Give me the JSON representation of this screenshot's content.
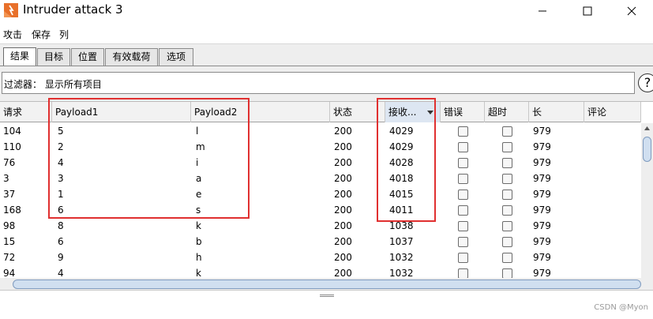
{
  "window": {
    "title": "Intruder attack 3"
  },
  "menu": [
    "攻击",
    "保存",
    "列"
  ],
  "tabs": [
    "结果",
    "目标",
    "位置",
    "有效载荷",
    "选项"
  ],
  "filter": {
    "text": "过滤器：  显示所有项目"
  },
  "help_label": "?",
  "table": {
    "columns": [
      "请求",
      "Payload1",
      "Payload2",
      "状态",
      "接收...",
      "错误",
      "超时",
      "长",
      "评论"
    ],
    "rows": [
      [
        "104",
        "5",
        "l",
        "200",
        "4029",
        "979"
      ],
      [
        "110",
        "2",
        "m",
        "200",
        "4029",
        "979"
      ],
      [
        "76",
        "4",
        "i",
        "200",
        "4028",
        "979"
      ],
      [
        "3",
        "3",
        "a",
        "200",
        "4018",
        "979"
      ],
      [
        "37",
        "1",
        "e",
        "200",
        "4015",
        "979"
      ],
      [
        "168",
        "6",
        "s",
        "200",
        "4011",
        "979"
      ],
      [
        "98",
        "8",
        "k",
        "200",
        "1038",
        "979"
      ],
      [
        "15",
        "6",
        "b",
        "200",
        "1037",
        "979"
      ],
      [
        "72",
        "9",
        "h",
        "200",
        "1032",
        "979"
      ],
      [
        "94",
        "4",
        "k",
        "200",
        "1032",
        "979"
      ]
    ]
  },
  "watermark": "CSDN @Myon⁣",
  "colors": {
    "highlight": "#e03030",
    "sorted_header": "#dde6f2",
    "scroll_thumb": "#d0dff0"
  }
}
